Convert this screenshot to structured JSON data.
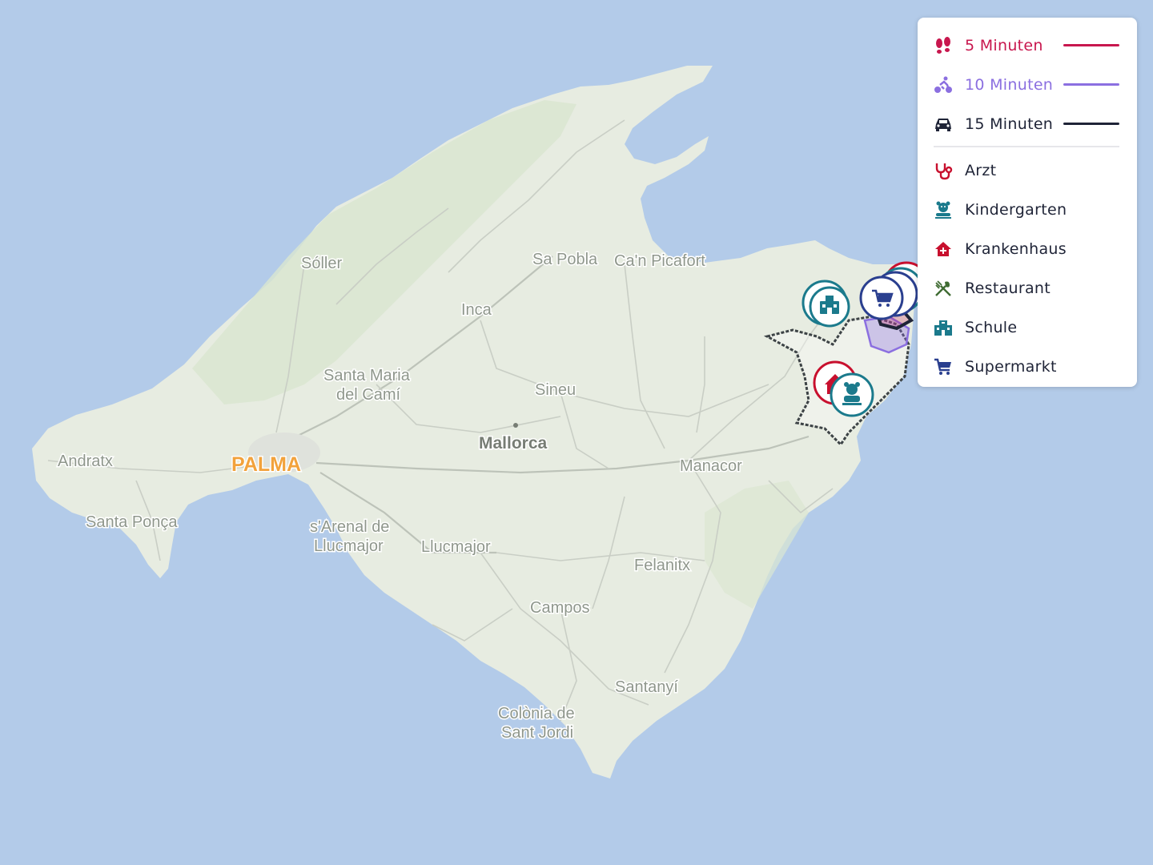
{
  "map": {
    "colors": {
      "water": "#b3cbe9",
      "land": "#e7ece1",
      "green": "#d9e6cf",
      "road": "#c9cec5"
    },
    "labels": {
      "soller": "Sóller",
      "sa_pobla": "Sa Pobla",
      "can_picafort": "Ca'n Picafort",
      "inca": "Inca",
      "santa_maria_1": "Santa Maria",
      "santa_maria_2": "del Camí",
      "sineu": "Sineu",
      "mallorca": "Mallorca",
      "andratx": "Andratx",
      "palma": "PALMA",
      "manacor": "Manacor",
      "santa_ponsa": "Santa Ponça",
      "arenal_1": "s'Arenal de",
      "arenal_2": "Llucmajor",
      "llucmajor": "Llucmajor",
      "felanitx": "Felanitx",
      "campos": "Campos",
      "santanyi": "Santanyí",
      "colonia_1": "Colònia de",
      "colonia_2": "Sant Jordi"
    },
    "markers": [
      {
        "category": "Schule",
        "icon": "school-icon",
        "color": "#1b7a8c"
      },
      {
        "category": "Supermarkt",
        "icon": "cart-icon",
        "color": "#2a3f8f"
      },
      {
        "category": "Krankenhaus",
        "icon": "hospital-icon",
        "color": "#c8102e"
      },
      {
        "category": "Kindergarten",
        "icon": "kindergarten-icon",
        "color": "#1b7a8c"
      }
    ]
  },
  "legend": {
    "isochrones": [
      {
        "label": "5 Minuten",
        "icon": "footprints-icon",
        "color": "#c8174e"
      },
      {
        "label": "10 Minuten",
        "icon": "bicycle-icon",
        "color": "#8b6fe0"
      },
      {
        "label": "15 Minuten",
        "icon": "car-icon",
        "color": "#1f2437"
      }
    ],
    "categories": [
      {
        "label": "Arzt",
        "icon": "stethoscope-icon",
        "color": "#c8102e"
      },
      {
        "label": "Kindergarten",
        "icon": "kindergarten-icon",
        "color": "#1b7a8c"
      },
      {
        "label": "Krankenhaus",
        "icon": "hospital-icon",
        "color": "#c8102e"
      },
      {
        "label": "Restaurant",
        "icon": "restaurant-icon",
        "color": "#3f6b32"
      },
      {
        "label": "Schule",
        "icon": "school-icon",
        "color": "#1b7a8c"
      },
      {
        "label": "Supermarkt",
        "icon": "cart-icon",
        "color": "#2a3f8f"
      }
    ]
  }
}
